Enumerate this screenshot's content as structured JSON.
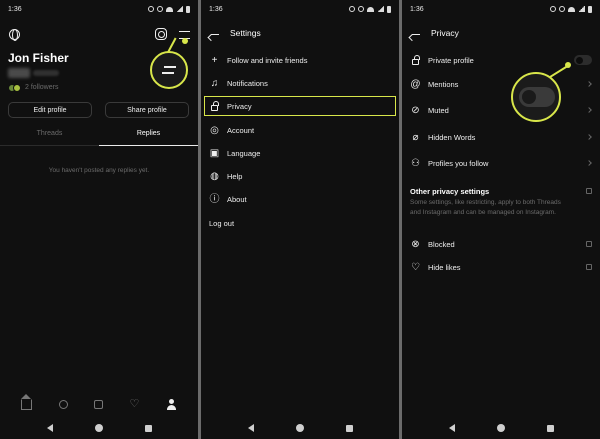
{
  "status": {
    "time": "1:36"
  },
  "profile": {
    "name": "Jon Fisher",
    "followers": "2 followers",
    "edit_profile": "Edit profile",
    "share_profile": "Share profile",
    "tabs": [
      "Threads",
      "Replies"
    ],
    "active_tab": "Replies",
    "empty_message": "You haven't posted any replies yet.",
    "bottom_nav": [
      "home-icon",
      "search-icon",
      "new-post-icon",
      "heart-icon",
      "profile-icon"
    ]
  },
  "settings": {
    "title": "Settings",
    "items": [
      {
        "label": "Follow and invite friends",
        "icon": "add-person-icon"
      },
      {
        "label": "Notifications",
        "icon": "bell-icon"
      },
      {
        "label": "Privacy",
        "icon": "lock-icon"
      },
      {
        "label": "Account",
        "icon": "account-icon"
      },
      {
        "label": "Language",
        "icon": "language-icon"
      },
      {
        "label": "Help",
        "icon": "help-icon"
      },
      {
        "label": "About",
        "icon": "info-icon"
      }
    ],
    "logout": "Log out"
  },
  "privacy": {
    "title": "Privacy",
    "private_profile": "Private profile",
    "private_profile_on": false,
    "items": [
      {
        "label": "Mentions",
        "icon": "at-icon"
      },
      {
        "label": "Muted",
        "icon": "muted-icon"
      },
      {
        "label": "Hidden Words",
        "icon": "hidden-icon"
      },
      {
        "label": "Profiles you follow",
        "icon": "people-icon"
      }
    ],
    "other_title": "Other privacy settings",
    "other_desc": "Some settings, like restricting, apply to both Threads and Instagram and can be managed on Instagram.",
    "other_items": [
      {
        "label": "Blocked",
        "icon": "blocked-icon"
      },
      {
        "label": "Hide likes",
        "icon": "hide-likes-icon"
      }
    ]
  },
  "colors": {
    "highlight": "#d8e64a",
    "background": "#101010"
  }
}
